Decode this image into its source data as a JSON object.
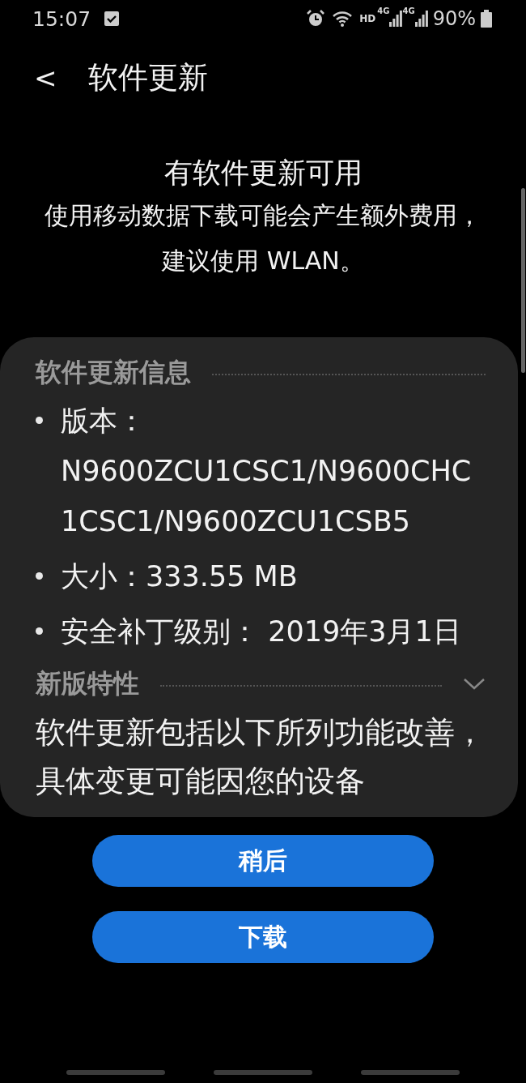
{
  "status_bar": {
    "time": "15:07",
    "network": "HD",
    "signal_labels": [
      "4G",
      "4G"
    ],
    "battery": "90%"
  },
  "header": {
    "back": "<",
    "title": "软件更新"
  },
  "hero": {
    "title": "有软件更新可用",
    "subtitle": "使用移动数据下载可能会产生额外费用，建议使用 WLAN。"
  },
  "card": {
    "info_heading": "软件更新信息",
    "info_items": [
      "版本：N9600ZCU1CSC1/N9600CHC1CSC1/N9600ZCU1CSB5",
      "大小：333.55 MB",
      "安全补丁级别： 2019年3月1日"
    ],
    "features": {
      "heading": "新版特性",
      "expanded": false,
      "text": "软件更新包括以下所列功能改善，具体变更可能因您的设备"
    }
  },
  "buttons": [
    {
      "label": "稍后"
    },
    {
      "label": "下载"
    }
  ]
}
